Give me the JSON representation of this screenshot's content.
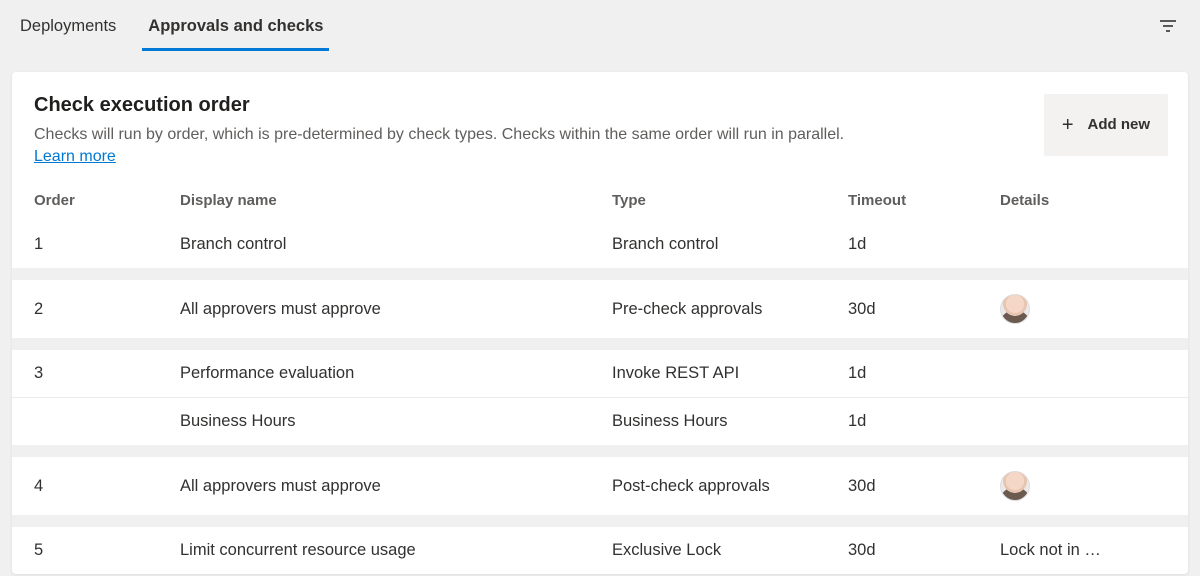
{
  "tabs": {
    "deployments": "Deployments",
    "approvals": "Approvals and checks"
  },
  "card": {
    "title": "Check execution order",
    "description": "Checks will run by order, which is pre-determined by check types. Checks within the same order will run in parallel.",
    "learn_more": "Learn more",
    "add_new": "Add new"
  },
  "columns": {
    "order": "Order",
    "display_name": "Display name",
    "type": "Type",
    "timeout": "Timeout",
    "details": "Details"
  },
  "rows": {
    "r1": {
      "order": "1",
      "name": "Branch control",
      "type": "Branch control",
      "timeout": "1d",
      "details": ""
    },
    "r2": {
      "order": "2",
      "name": "All approvers must approve",
      "type": "Pre-check approvals",
      "timeout": "30d",
      "details": ""
    },
    "r3": {
      "order": "3",
      "name": "Performance evaluation",
      "type": "Invoke REST API",
      "timeout": "1d",
      "details": ""
    },
    "r4": {
      "order": "",
      "name": "Business Hours",
      "type": "Business Hours",
      "timeout": "1d",
      "details": ""
    },
    "r5": {
      "order": "4",
      "name": "All approvers must approve",
      "type": "Post-check approvals",
      "timeout": "30d",
      "details": ""
    },
    "r6": {
      "order": "5",
      "name": "Limit concurrent resource usage",
      "type": "Exclusive Lock",
      "timeout": "30d",
      "details": "Lock not in …"
    }
  }
}
